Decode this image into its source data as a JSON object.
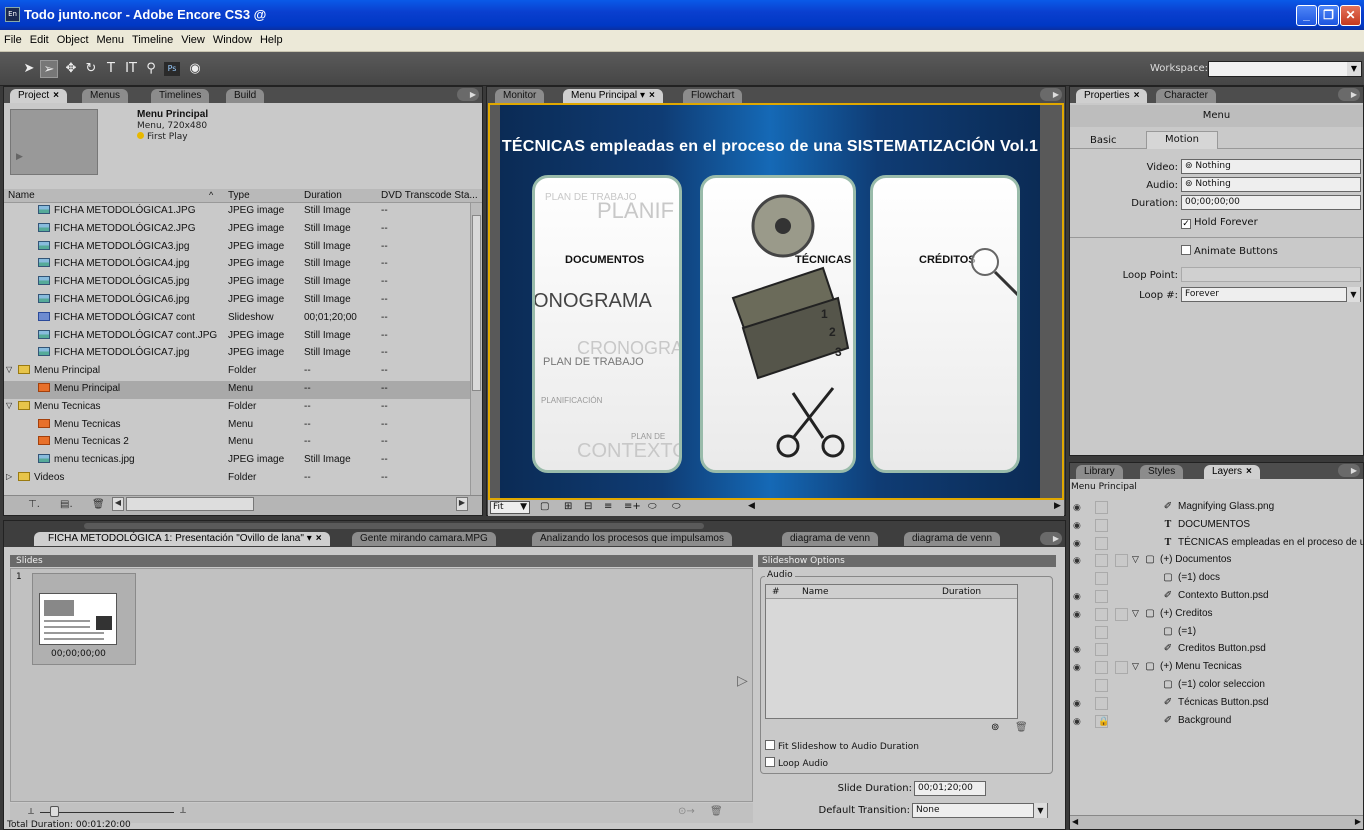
{
  "window": {
    "title": "Todo junto.ncor - Adobe Encore CS3 @",
    "icon": "En"
  },
  "menubar": [
    "File",
    "Edit",
    "Object",
    "Menu",
    "Timeline",
    "View",
    "Window",
    "Help"
  ],
  "toolbar": {
    "workspace_label": "Workspace:",
    "tools": [
      "pointer-icon",
      "direct-select-icon",
      "move-icon",
      "rotate-icon",
      "text-icon",
      "vertical-text-icon",
      "zoom-icon",
      "photoshop-icon",
      "preview-icon"
    ]
  },
  "project": {
    "tabs": [
      "Project",
      "Menus",
      "Timelines",
      "Build"
    ],
    "item_name": "Menu Principal",
    "item_info": "Menu, 720x480",
    "first_play": "First Play",
    "columns": [
      "Name",
      "Type",
      "Duration",
      "DVD Transcode Sta..."
    ],
    "rows": [
      {
        "name": "FICHA METODOLÓGICA1.JPG",
        "type": "JPEG image",
        "duration": "Still Image",
        "status": "--",
        "icon": "jpg",
        "indent": 1
      },
      {
        "name": "FICHA METODOLÓGICA2.JPG",
        "type": "JPEG image",
        "duration": "Still Image",
        "status": "--",
        "icon": "jpg",
        "indent": 1
      },
      {
        "name": "FICHA METODOLÓGICA3.jpg",
        "type": "JPEG image",
        "duration": "Still Image",
        "status": "--",
        "icon": "jpg",
        "indent": 1
      },
      {
        "name": "FICHA METODOLÓGICA4.jpg",
        "type": "JPEG image",
        "duration": "Still Image",
        "status": "--",
        "icon": "jpg",
        "indent": 1
      },
      {
        "name": "FICHA METODOLÓGICA5.jpg",
        "type": "JPEG image",
        "duration": "Still Image",
        "status": "--",
        "icon": "jpg",
        "indent": 1
      },
      {
        "name": "FICHA METODOLÓGICA6.jpg",
        "type": "JPEG image",
        "duration": "Still Image",
        "status": "--",
        "icon": "jpg",
        "indent": 1
      },
      {
        "name": "FICHA METODOLÓGICA7 cont",
        "type": "Slideshow",
        "duration": "00;01;20;00",
        "status": "--",
        "icon": "slide",
        "indent": 1
      },
      {
        "name": "FICHA METODOLÓGICA7 cont.JPG",
        "type": "JPEG image",
        "duration": "Still Image",
        "status": "--",
        "icon": "jpg",
        "indent": 1
      },
      {
        "name": "FICHA METODOLÓGICA7.jpg",
        "type": "JPEG image",
        "duration": "Still Image",
        "status": "--",
        "icon": "jpg",
        "indent": 1
      },
      {
        "name": "Menu Principal",
        "type": "Folder",
        "duration": "--",
        "status": "--",
        "icon": "folder",
        "indent": 0,
        "expanded": true
      },
      {
        "name": "Menu Principal",
        "type": "Menu",
        "duration": "--",
        "status": "--",
        "icon": "menu",
        "indent": 1,
        "selected": true
      },
      {
        "name": "Menu Tecnicas",
        "type": "Folder",
        "duration": "--",
        "status": "--",
        "icon": "folder",
        "indent": 0,
        "expanded": true
      },
      {
        "name": "Menu Tecnicas",
        "type": "Menu",
        "duration": "--",
        "status": "--",
        "icon": "menu",
        "indent": 1
      },
      {
        "name": "Menu Tecnicas 2",
        "type": "Menu",
        "duration": "--",
        "status": "--",
        "icon": "menu",
        "indent": 1
      },
      {
        "name": "menu tecnicas.jpg",
        "type": "JPEG image",
        "duration": "Still Image",
        "status": "--",
        "icon": "jpg",
        "indent": 1
      },
      {
        "name": "Videos",
        "type": "Folder",
        "duration": "--",
        "status": "--",
        "icon": "folder",
        "indent": 0,
        "expanded": false
      }
    ]
  },
  "monitor": {
    "tabs": [
      "Monitor",
      "Menu Principal",
      "Flowchart"
    ],
    "menu_title": "TÉCNICAS empleadas en el proceso de una SISTEMATIZACIÓN Vol.1",
    "buttons": [
      "DOCUMENTOS",
      "TÉCNICAS",
      "CRÉDITOS"
    ],
    "card_text": [
      "PLAN DE TRABAJO",
      "PLANIF",
      "ONOGRAMA",
      "CRONOGRAM",
      "PLAN DE TRABAJO",
      "PLANIFICACIÓN",
      "PLAN DE",
      "CONTEXTO"
    ],
    "frame_labels": [
      "1",
      "2",
      "3"
    ],
    "fit": "Fit"
  },
  "slideshow": {
    "tabs": [
      "FICHA METODOLÓGICA 1: Presentación \"Ovillo de lana\"",
      "Gente mirando camara.MPG",
      "Analizando los procesos que impulsamos",
      "diagrama de venn",
      "diagrama de venn"
    ],
    "slides_label": "Slides",
    "slide_number": "1",
    "slide_time": "00;00;00;00",
    "total_duration": "Total Duration:  00:01:20:00",
    "options": {
      "header": "Slideshow Options",
      "audio_label": "Audio",
      "columns": [
        "#",
        "Name",
        "Duration"
      ],
      "fit_audio": "Fit Slideshow to Audio Duration",
      "loop_audio": "Loop Audio",
      "slide_duration_label": "Slide Duration:",
      "slide_duration": "00;01;20;00",
      "transition_label": "Default Transition:",
      "transition": "None"
    }
  },
  "properties": {
    "tabs": [
      "Properties",
      "Character"
    ],
    "object": "Menu",
    "subtabs": [
      "Basic",
      "Motion"
    ],
    "video_label": "Video:",
    "video": "Nothing",
    "audio_label": "Audio:",
    "audio": "Nothing",
    "duration_label": "Duration:",
    "duration": "00;00;00;00",
    "hold_forever": "Hold Forever",
    "animate_buttons": "Animate Buttons",
    "loop_point_label": "Loop Point:",
    "loop_count_label": "Loop #:",
    "loop_count": "Forever"
  },
  "layers": {
    "tabs": [
      "Library",
      "Styles",
      "Layers"
    ],
    "menu_name": "Menu Principal",
    "rows": [
      {
        "name": "Magnifying Glass.png",
        "kind": "brush",
        "indent": 2,
        "eye": true
      },
      {
        "name": "DOCUMENTOS",
        "kind": "text",
        "indent": 2,
        "eye": true
      },
      {
        "name": "TÉCNICAS empleadas en el proceso de un",
        "kind": "text",
        "indent": 2,
        "eye": true
      },
      {
        "name": "(+) Documentos",
        "kind": "folder",
        "indent": 1,
        "eye": true
      },
      {
        "name": "(=1) docs",
        "kind": "layer",
        "indent": 2,
        "eye": false
      },
      {
        "name": "Contexto Button.psd",
        "kind": "brush",
        "indent": 2,
        "eye": true
      },
      {
        "name": "(+) Creditos",
        "kind": "folder",
        "indent": 1,
        "eye": true
      },
      {
        "name": "(=1)",
        "kind": "layer",
        "indent": 2,
        "eye": false
      },
      {
        "name": "Creditos Button.psd",
        "kind": "brush",
        "indent": 2,
        "eye": true
      },
      {
        "name": "(+) Menu Tecnicas",
        "kind": "folder",
        "indent": 1,
        "eye": true
      },
      {
        "name": "(=1) color seleccion",
        "kind": "layer",
        "indent": 2,
        "eye": false
      },
      {
        "name": "Técnicas Button.psd",
        "kind": "brush",
        "indent": 2,
        "eye": true
      },
      {
        "name": "Background",
        "kind": "brush",
        "indent": 2,
        "eye": true,
        "locked": true
      }
    ]
  }
}
